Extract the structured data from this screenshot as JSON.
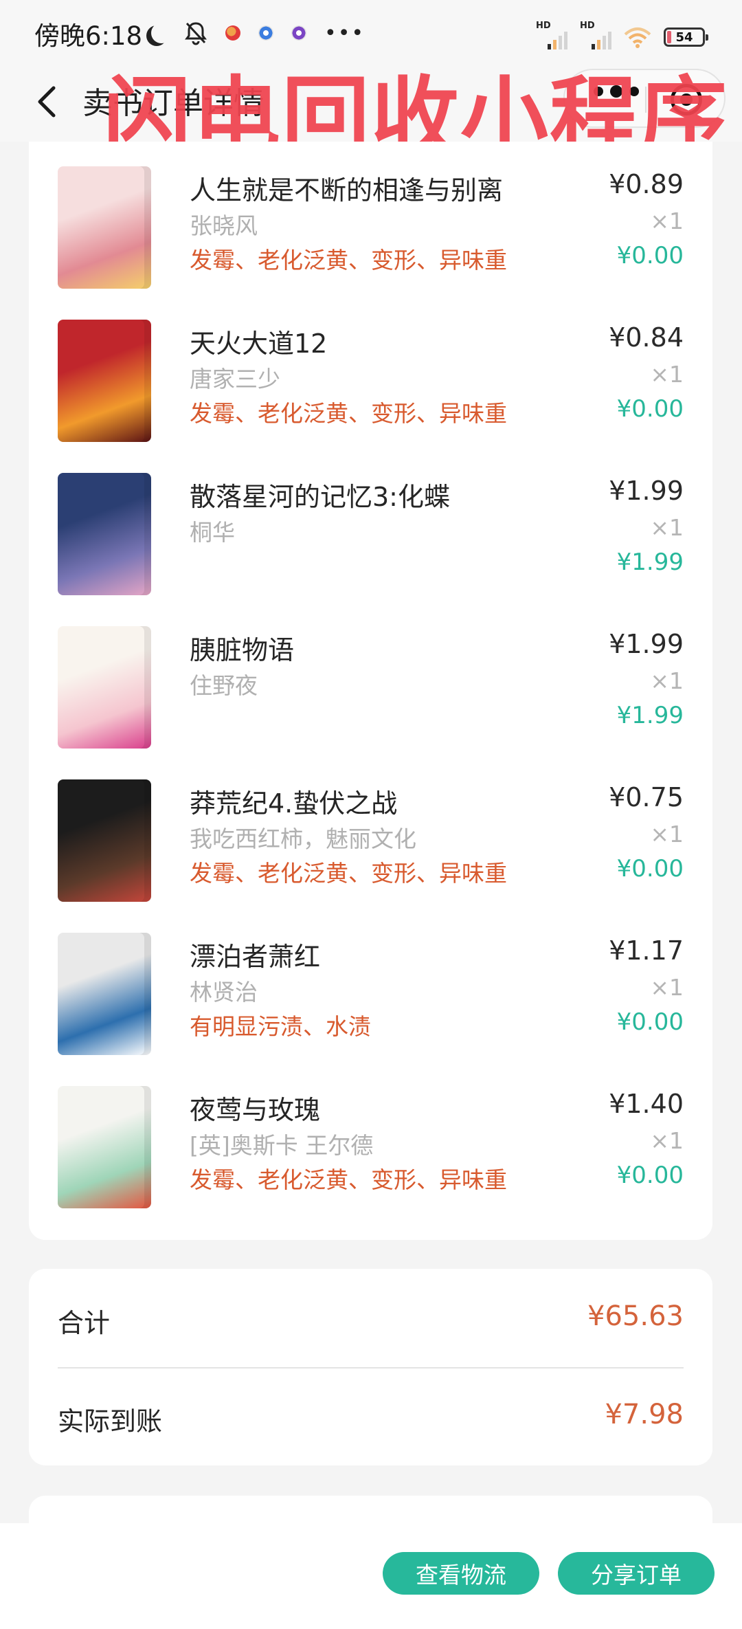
{
  "status_bar": {
    "time": "傍晚6:18",
    "battery": "54",
    "network_1": "HD",
    "network_2": "HD"
  },
  "nav": {
    "title": "卖书订单详情",
    "watermark": "闪电回收小程序"
  },
  "books": [
    {
      "title": "人生就是不断的相逢与别离",
      "author": "张晓风",
      "defects": "发霉、老化泛黄、变形、异味重",
      "price": "¥0.89",
      "qty": "×1",
      "final": "¥0.00",
      "cover_colors": [
        "#f6dede",
        "#e28a93",
        "#f5d06a"
      ]
    },
    {
      "title": "天火大道12",
      "author": "唐家三少",
      "defects": "发霉、老化泛黄、变形、异味重",
      "price": "¥0.84",
      "qty": "×1",
      "final": "¥0.00",
      "cover_colors": [
        "#c0262c",
        "#f19a2c",
        "#5a1214"
      ]
    },
    {
      "title": "散落星河的记忆3:化蝶",
      "author": "桐华",
      "defects": "",
      "price": "¥1.99",
      "qty": "×1",
      "final": "¥1.99",
      "cover_colors": [
        "#2b3f73",
        "#7a76b5",
        "#e6a6c6"
      ]
    },
    {
      "title": "胰脏物语",
      "author": "住野夜",
      "defects": "",
      "price": "¥1.99",
      "qty": "×1",
      "final": "¥1.99",
      "cover_colors": [
        "#f9f4ee",
        "#f5c5cf",
        "#d93d8b"
      ]
    },
    {
      "title": "莽荒纪4.蛰伏之战",
      "author": "我吃西红柿，魅丽文化",
      "defects": "发霉、老化泛黄、变形、异味重",
      "price": "¥0.75",
      "qty": "×1",
      "final": "¥0.00",
      "cover_colors": [
        "#1c1c1c",
        "#5b3a2a",
        "#c6463b"
      ]
    },
    {
      "title": "漂泊者萧红",
      "author": "林贤治",
      "defects": "有明显污渍、水渍",
      "price": "¥1.17",
      "qty": "×1",
      "final": "¥0.00",
      "cover_colors": [
        "#e9e9e9",
        "#2d6fae",
        "#ffffff"
      ]
    },
    {
      "title": "夜莺与玫瑰",
      "author": "[英]奥斯卡 王尔德",
      "defects": "发霉、老化泛黄、变形、异味重",
      "price": "¥1.40",
      "qty": "×1",
      "final": "¥0.00",
      "cover_colors": [
        "#f4f4f0",
        "#9fd5b8",
        "#e4553f"
      ]
    }
  ],
  "totals": {
    "total_label": "合计",
    "total_value": "¥65.63",
    "actual_label": "实际到账",
    "actual_value": "¥7.98"
  },
  "actions": {
    "logistics": "查看物流",
    "share": "分享订单"
  },
  "colors": {
    "accent_green": "#27b89b",
    "price_orange": "#d4633b",
    "defect_orange": "#d85a2e",
    "watermark_red": "#f0434f"
  }
}
